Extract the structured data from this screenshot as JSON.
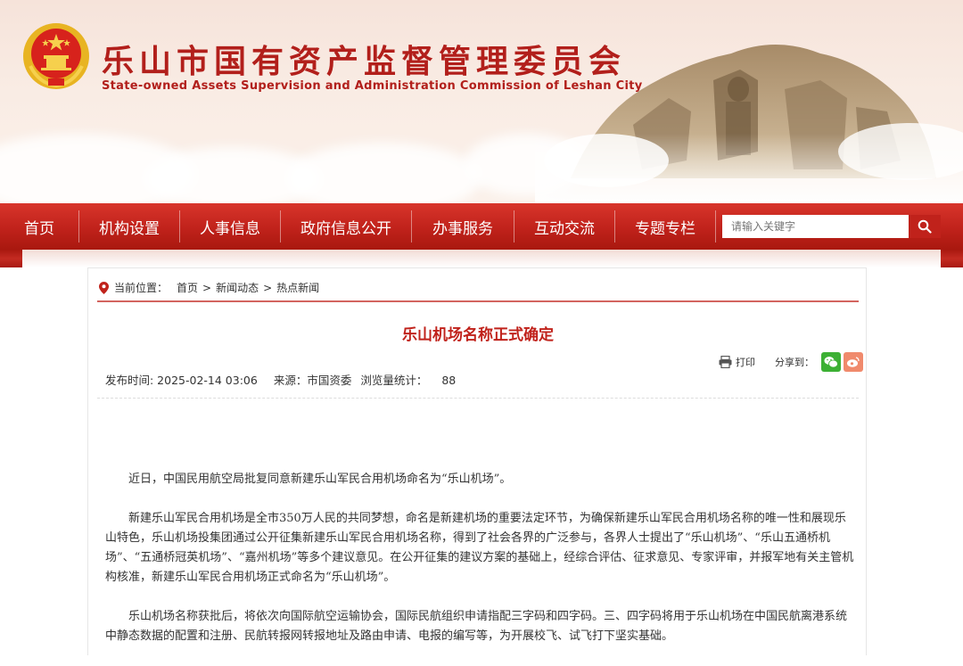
{
  "header": {
    "title_cn": "乐山市国有资产监督管理委员会",
    "title_en": "State-owned Assets Supervision and Administration Commission of Leshan City",
    "emblem": "national-emblem-icon"
  },
  "nav": {
    "items": [
      "首页",
      "机构设置",
      "人事信息",
      "政府信息公开",
      "办事服务",
      "互动交流",
      "专题专栏"
    ],
    "search_placeholder": "请输入关键字",
    "search_icon": "search-icon"
  },
  "breadcrumb": {
    "label": "当前位置：",
    "items": [
      "首页",
      "新闻动态",
      "热点新闻"
    ],
    "separator": ">"
  },
  "article": {
    "title": "乐山机场名称正式确定",
    "publish_time": "发布时间: 2025-02-14 03:06",
    "source": "来源：市国资委",
    "views_label": "浏览量统计：",
    "views": "88",
    "print_label": "打印",
    "share_label": "分享到：",
    "paragraphs": [
      "近日，中国民用航空局批复同意新建乐山军民合用机场命名为“乐山机场”。",
      "新建乐山军民合用机场是全市350万人民的共同梦想，命名是新建机场的重要法定环节，为确保新建乐山军民合用机场名称的唯一性和展现乐山特色，乐山机场投集团通过公开征集新建乐山军民合用机场名称，得到了社会各界的广泛参与，各界人士提出了“乐山机场”、“乐山五通桥机场”、“五通桥冠英机场”、“嘉州机场”等多个建议意见。在公开征集的建议方案的基础上，经综合评估、征求意见、专家评审，并报军地有关主管机构核准，新建乐山军民合用机场正式命名为“乐山机场”。",
      "乐山机场名称获批后，将依次向国际航空运输协会，国际民航组织申请指配三字码和四字码。三、四字码将用于乐山机场在中国民航离港系统中静态数据的配置和注册、民航转报网转报地址及路由申请、电报的编写等，为开展校飞、试飞打下坚实基础。"
    ]
  },
  "colors": {
    "brand_red": "#c0221b",
    "title_red": "#b21f1b",
    "wechat_green": "#3cb034",
    "weibo_orange": "#f08a6c"
  }
}
